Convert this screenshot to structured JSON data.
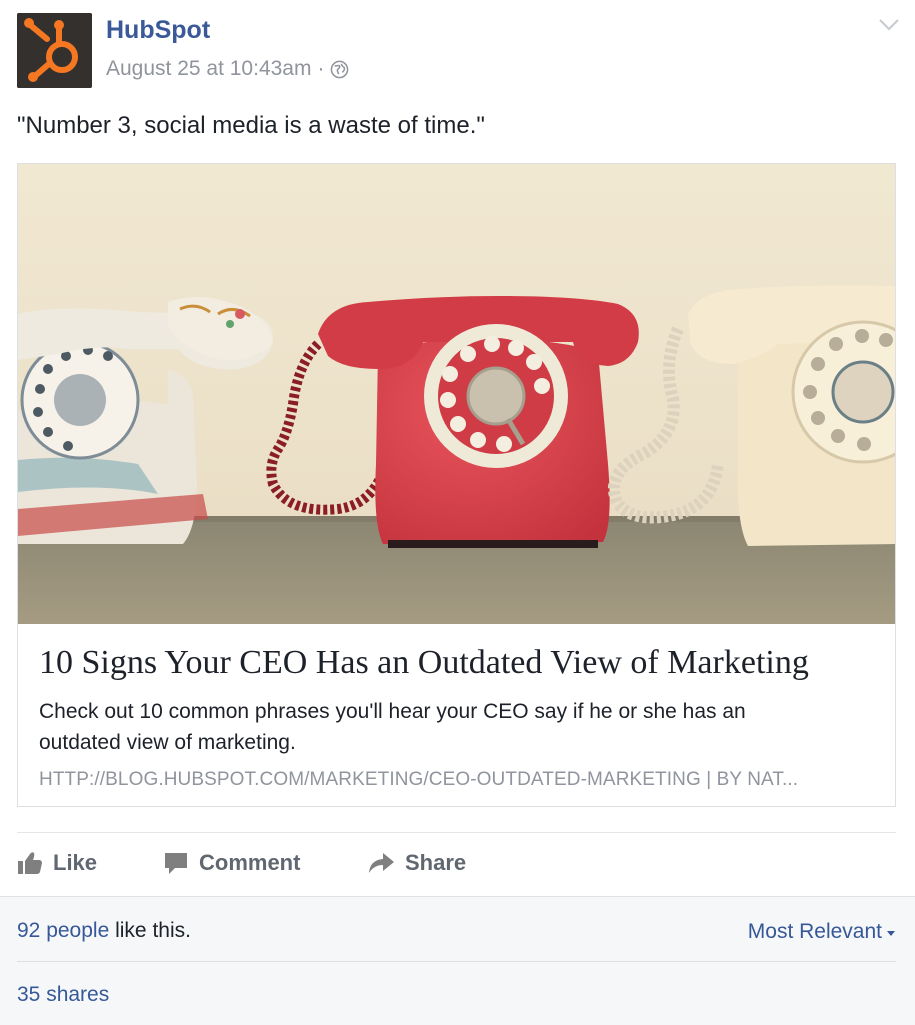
{
  "post": {
    "author": "HubSpot",
    "timestamp": "August 25 at 10:43am",
    "separator": "·",
    "privacy_icon": "globe-icon",
    "message": "\"Number 3, social media is a waste of time.\""
  },
  "link_card": {
    "title": "10 Signs Your CEO Has an Outdated View of Marketing",
    "description": "Check out 10 common phrases you'll hear your CEO say if he or she has an outdated view of marketing.",
    "url_line": "HTTP://BLOG.HUBSPOT.COM/MARKETING/CEO-OUTDATED-MARKETING  |  BY NAT..."
  },
  "actions": {
    "like": "Like",
    "comment": "Comment",
    "share": "Share"
  },
  "footer": {
    "likes_count": "92 people",
    "likes_suffix": " like this.",
    "sort": "Most Relevant",
    "shares": "35 shares"
  },
  "colors": {
    "link_blue": "#365899",
    "author_blue": "#3b5998",
    "hubspot_orange": "#f57722",
    "muted_gray": "#90949c"
  }
}
